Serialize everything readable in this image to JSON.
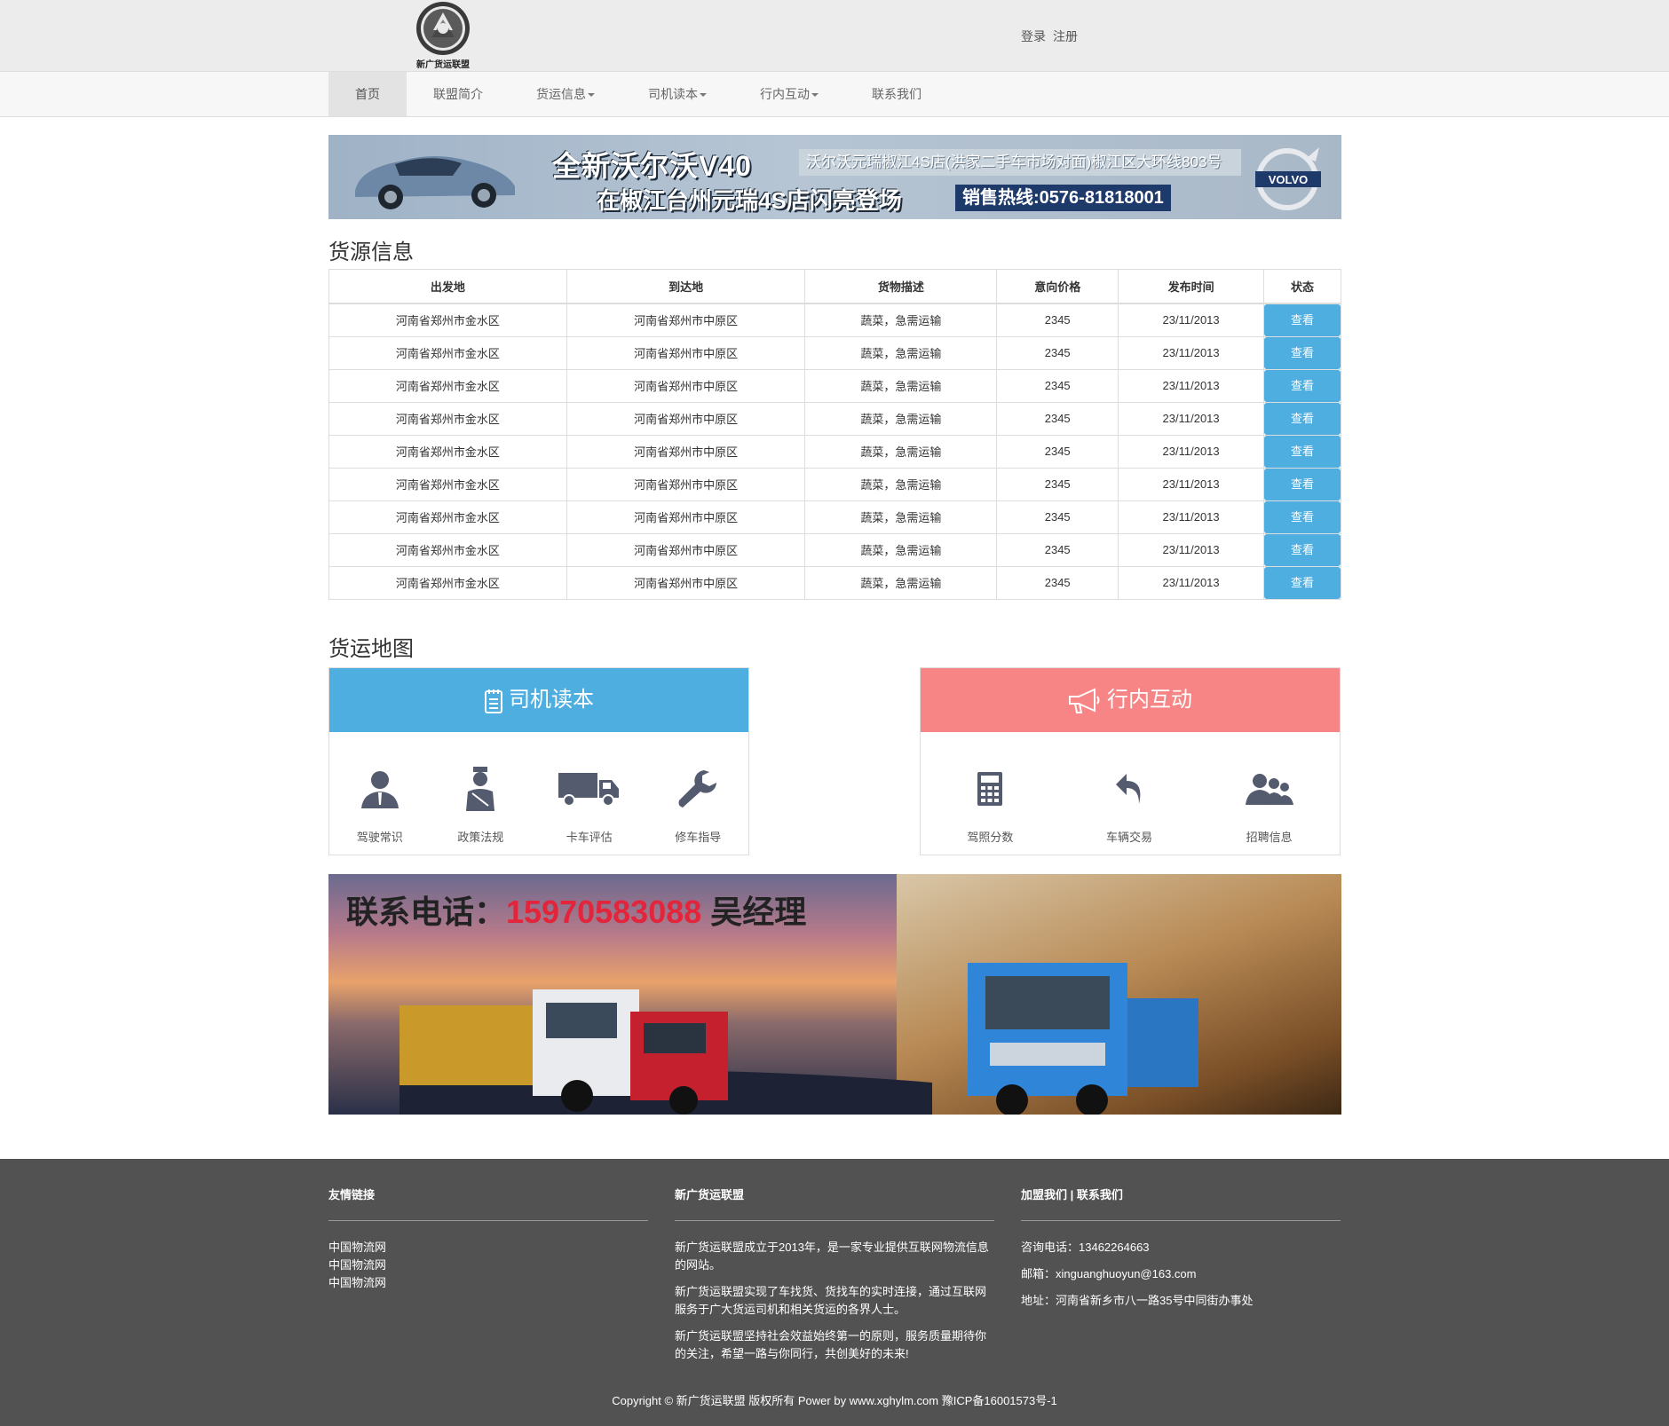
{
  "header": {
    "logo_text": "新广货运联盟",
    "login": "登录",
    "register": "注册"
  },
  "nav": {
    "items": [
      {
        "label": "首页",
        "dropdown": false
      },
      {
        "label": "联盟简介",
        "dropdown": false
      },
      {
        "label": "货运信息",
        "dropdown": true
      },
      {
        "label": "司机读本",
        "dropdown": true
      },
      {
        "label": "行内互动",
        "dropdown": true
      },
      {
        "label": "联系我们",
        "dropdown": false
      }
    ]
  },
  "ad_top": {
    "headline": "全新沃尔沃V40",
    "subline": "在椒江台州元瑞4S店闪亮登场",
    "address": "沃尔沃元瑞椒江4S店(洪家二手车市场对面)椒江区大环线803号",
    "hotline_label": "销售热线:",
    "hotline": "0576-81818001",
    "brand": "VOLVO"
  },
  "cargo": {
    "title": "货源信息",
    "columns": [
      "出发地",
      "到达地",
      "货物描述",
      "意向价格",
      "发布时间",
      "状态"
    ],
    "rows": [
      [
        "河南省郑州市金水区",
        "河南省郑州市中原区",
        "蔬菜，急需运输",
        "2345",
        "23/11/2013",
        "查看"
      ],
      [
        "河南省郑州市金水区",
        "河南省郑州市中原区",
        "蔬菜，急需运输",
        "2345",
        "23/11/2013",
        "查看"
      ],
      [
        "河南省郑州市金水区",
        "河南省郑州市中原区",
        "蔬菜，急需运输",
        "2345",
        "23/11/2013",
        "查看"
      ],
      [
        "河南省郑州市金水区",
        "河南省郑州市中原区",
        "蔬菜，急需运输",
        "2345",
        "23/11/2013",
        "查看"
      ],
      [
        "河南省郑州市金水区",
        "河南省郑州市中原区",
        "蔬菜，急需运输",
        "2345",
        "23/11/2013",
        "查看"
      ],
      [
        "河南省郑州市金水区",
        "河南省郑州市中原区",
        "蔬菜，急需运输",
        "2345",
        "23/11/2013",
        "查看"
      ],
      [
        "河南省郑州市金水区",
        "河南省郑州市中原区",
        "蔬菜，急需运输",
        "2345",
        "23/11/2013",
        "查看"
      ],
      [
        "河南省郑州市金水区",
        "河南省郑州市中原区",
        "蔬菜，急需运输",
        "2345",
        "23/11/2013",
        "查看"
      ],
      [
        "河南省郑州市金水区",
        "河南省郑州市中原区",
        "蔬菜，急需运输",
        "2345",
        "23/11/2013",
        "查看"
      ]
    ]
  },
  "map": {
    "title": "货运地图"
  },
  "driver_panel": {
    "title": "司机读本",
    "color": "#4eaee0",
    "items": [
      {
        "label": "驾驶常识",
        "icon": "person-icon"
      },
      {
        "label": "政策法规",
        "icon": "officer-icon"
      },
      {
        "label": "卡车评估",
        "icon": "truck-icon"
      },
      {
        "label": "修车指导",
        "icon": "wrench-icon"
      }
    ]
  },
  "interact_panel": {
    "title": "行内互动",
    "color": "#f78585",
    "items": [
      {
        "label": "驾照分数",
        "icon": "calculator-icon"
      },
      {
        "label": "车辆交易",
        "icon": "reply-icon"
      },
      {
        "label": "招聘信息",
        "icon": "users-icon"
      }
    ]
  },
  "ad_bottom": {
    "phone_label": "联系电话：",
    "phone": "15970583088",
    "contact": " 吴经理"
  },
  "footer": {
    "links_title": "友情链接",
    "links": [
      "中国物流网",
      "中国物流网",
      "中国物流网"
    ],
    "about_title": "新广货运联盟",
    "about": [
      "新广货运联盟成立于2013年，是一家专业提供互联网物流信息的网站。",
      "新广货运联盟实现了车找货、货找车的实时连接，通过互联网服务于广大货运司机和相关货运的各界人士。",
      "新广货运联盟坚持社会效益始终第一的原则，服务质量期待你的关注，希望一路与你同行，共创美好的未来!"
    ],
    "contact_title": "加盟我们 | 联系我们",
    "phone": "咨询电话：13462264663",
    "email": "邮箱：xinguanghuoyun@163.com",
    "address": "地址：河南省新乡市八一路35号中同街办事处",
    "copyright": "Copyright © 新广货运联盟 版权所有 Power by www.xghylm.com 豫ICP备16001573号-1"
  }
}
